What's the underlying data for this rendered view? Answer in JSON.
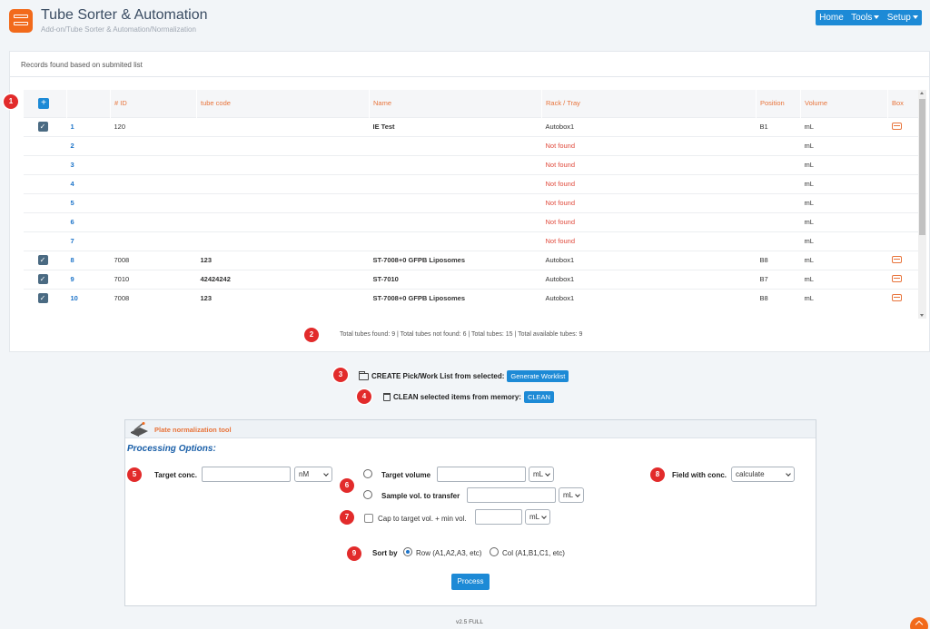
{
  "header": {
    "title": "Tube Sorter & Automation",
    "breadcrumb": "Add-on/Tube Sorter & Automation/Normalization",
    "nav": {
      "home": "Home",
      "tools": "Tools",
      "setup": "Setup"
    }
  },
  "records": {
    "heading": "Records found based on submited list",
    "add_label": "+",
    "columns": [
      "# ID",
      "tube code",
      "Name",
      "Rack / Tray",
      "Position",
      "Volume",
      "Box"
    ],
    "rows": [
      {
        "checked": true,
        "num": "1",
        "id": "120",
        "code": "",
        "name": "IE Test",
        "rack": "Autobox1",
        "nf": false,
        "pos": "B1",
        "vol": "mL",
        "box": true
      },
      {
        "checked": false,
        "num": "2",
        "id": "",
        "code": "",
        "name": "",
        "rack": "Not found",
        "nf": true,
        "pos": "",
        "vol": "mL",
        "box": false
      },
      {
        "checked": false,
        "num": "3",
        "id": "",
        "code": "",
        "name": "",
        "rack": "Not found",
        "nf": true,
        "pos": "",
        "vol": "mL",
        "box": false
      },
      {
        "checked": false,
        "num": "4",
        "id": "",
        "code": "",
        "name": "",
        "rack": "Not found",
        "nf": true,
        "pos": "",
        "vol": "mL",
        "box": false
      },
      {
        "checked": false,
        "num": "5",
        "id": "",
        "code": "",
        "name": "",
        "rack": "Not found",
        "nf": true,
        "pos": "",
        "vol": "mL",
        "box": false
      },
      {
        "checked": false,
        "num": "6",
        "id": "",
        "code": "",
        "name": "",
        "rack": "Not found",
        "nf": true,
        "pos": "",
        "vol": "mL",
        "box": false
      },
      {
        "checked": false,
        "num": "7",
        "id": "",
        "code": "",
        "name": "",
        "rack": "Not found",
        "nf": true,
        "pos": "",
        "vol": "mL",
        "box": false
      },
      {
        "checked": true,
        "num": "8",
        "id": "7008",
        "code": "123",
        "name": "ST-7008+0 GFPB Liposomes",
        "rack": "Autobox1",
        "nf": false,
        "pos": "B8",
        "vol": "mL",
        "box": true
      },
      {
        "checked": true,
        "num": "9",
        "id": "7010",
        "code": "42424242",
        "name": "ST-7010",
        "rack": "Autobox1",
        "nf": false,
        "pos": "B7",
        "vol": "mL",
        "box": true
      },
      {
        "checked": true,
        "num": "10",
        "id": "7008",
        "code": "123",
        "name": "ST-7008+0 GFPB Liposomes",
        "rack": "Autobox1",
        "nf": false,
        "pos": "B8",
        "vol": "mL",
        "box": true
      }
    ],
    "summary": "Total tubes found: 9 | Total tubes not found: 6 | Total tubes: 15 | Total available tubes: 9"
  },
  "actions": {
    "create_label": "CREATE Pick/Work List from selected:",
    "create_button": "Generate Worklist",
    "clean_label": "CLEAN selected items from memory:",
    "clean_button": "CLEAN"
  },
  "tool": {
    "title": "Plate normalization tool",
    "processing_title": "Processing Options:",
    "target_conc_label": "Target conc.",
    "target_conc_unit": "nM",
    "target_volume_label": "Target volume",
    "target_volume_unit": "mL",
    "sample_vol_label": "Sample vol. to transfer",
    "sample_vol_unit": "mL",
    "field_conc_label": "Field with conc.",
    "field_conc_value": "calculate",
    "cap_label": "Cap to target vol. + min vol.",
    "cap_unit": "mL",
    "sort_label": "Sort by",
    "sort_row": "Row (A1,A2,A3, etc)",
    "sort_col": "Col (A1,B1,C1, etc)",
    "process_button": "Process"
  },
  "callouts": [
    "1",
    "2",
    "3",
    "4",
    "5",
    "6",
    "7",
    "8",
    "9"
  ],
  "footer": {
    "version": "v2.5 FULL"
  },
  "colors": {
    "accent": "#1d8ad6",
    "brand": "#f26a1b",
    "callout": "#e22b2b",
    "header_text": "#e8743b",
    "not_found": "#e04a3c"
  }
}
